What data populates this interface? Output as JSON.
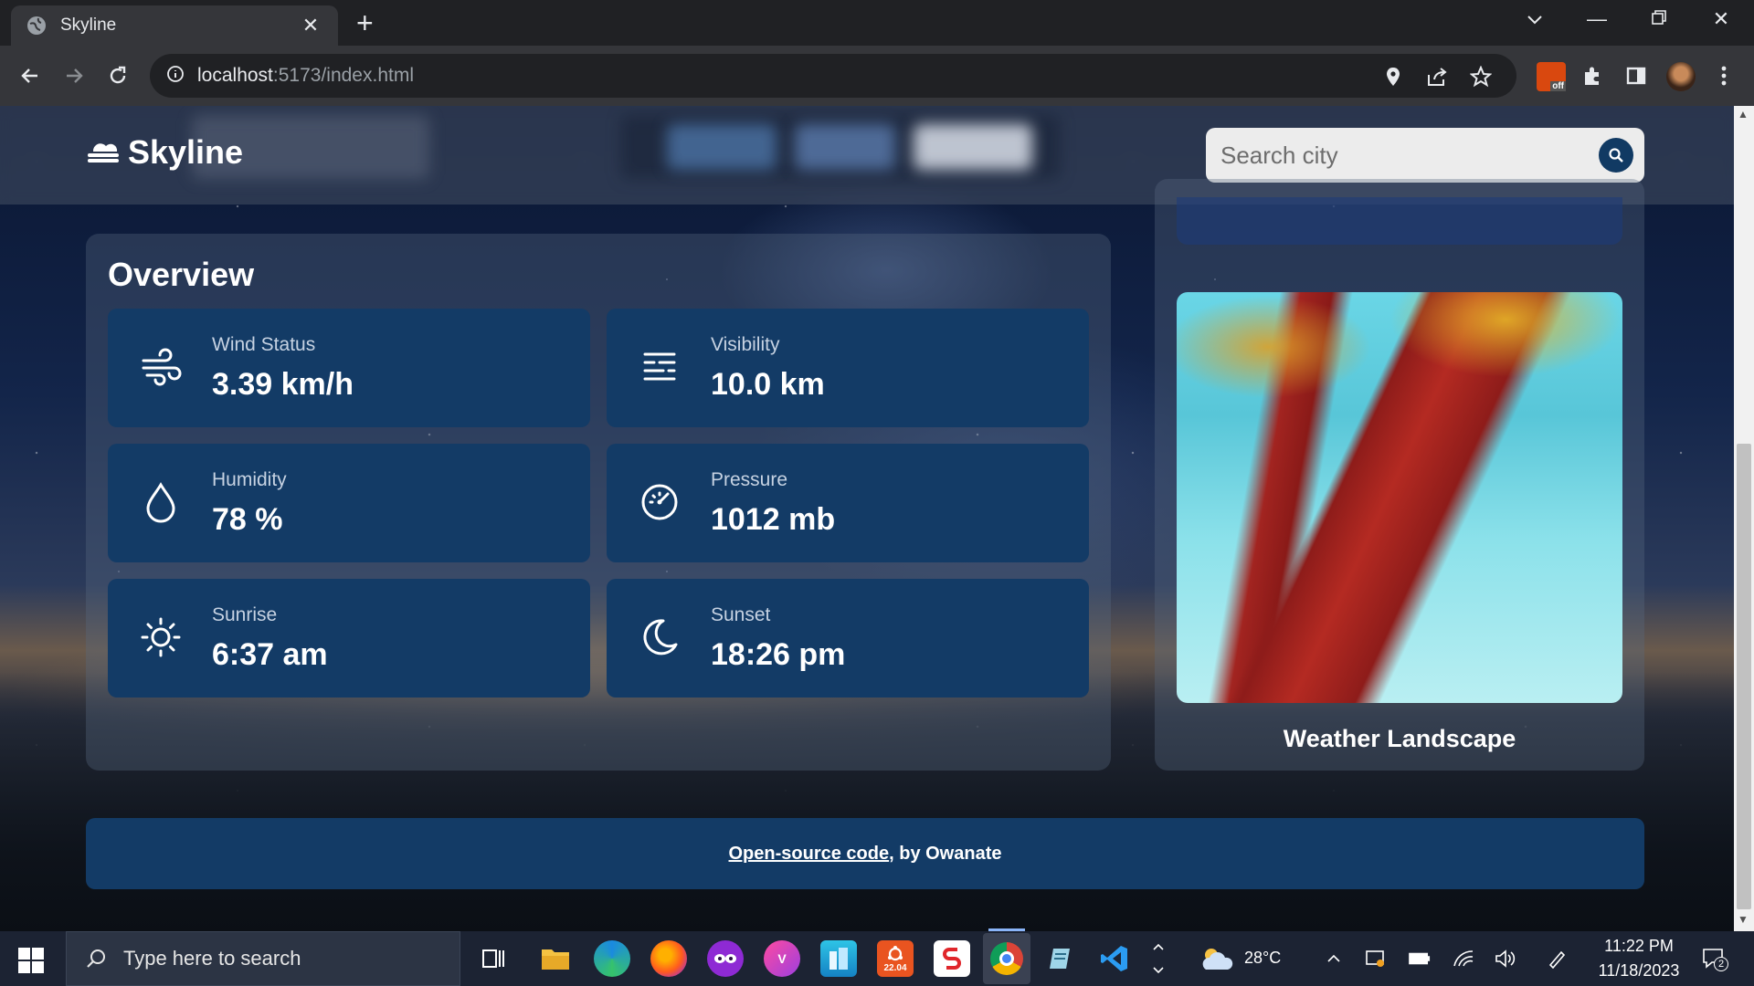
{
  "browser": {
    "tab_title": "Skyline",
    "url_host": "localhost",
    "url_rest": ":5173/index.html",
    "extension_badge": "off"
  },
  "app": {
    "brand": "Skyline",
    "search_placeholder": "Search city",
    "overview_title": "Overview",
    "cards": [
      {
        "label": "Wind Status",
        "value": "3.39 km/h",
        "icon": "wind-icon"
      },
      {
        "label": "Visibility",
        "value": "10.0 km",
        "icon": "visibility-icon"
      },
      {
        "label": "Humidity",
        "value": "78 %",
        "icon": "droplet-icon"
      },
      {
        "label": "Pressure",
        "value": "1012 mb",
        "icon": "gauge-icon"
      },
      {
        "label": "Sunrise",
        "value": "6:37 am",
        "icon": "sun-icon"
      },
      {
        "label": "Sunset",
        "value": "18:26 pm",
        "icon": "moon-icon"
      }
    ],
    "landscape_title": "Weather Landscape",
    "footer": {
      "link_text": "Open-source code",
      "suffix": ", by Owanate"
    }
  },
  "taskbar": {
    "search_placeholder": "Type here to search",
    "weather_temp": "28°C",
    "clock_time": "11:22 PM",
    "clock_date": "11/18/2023",
    "notification_count": "2",
    "ubuntu_badge": "22.04"
  }
}
